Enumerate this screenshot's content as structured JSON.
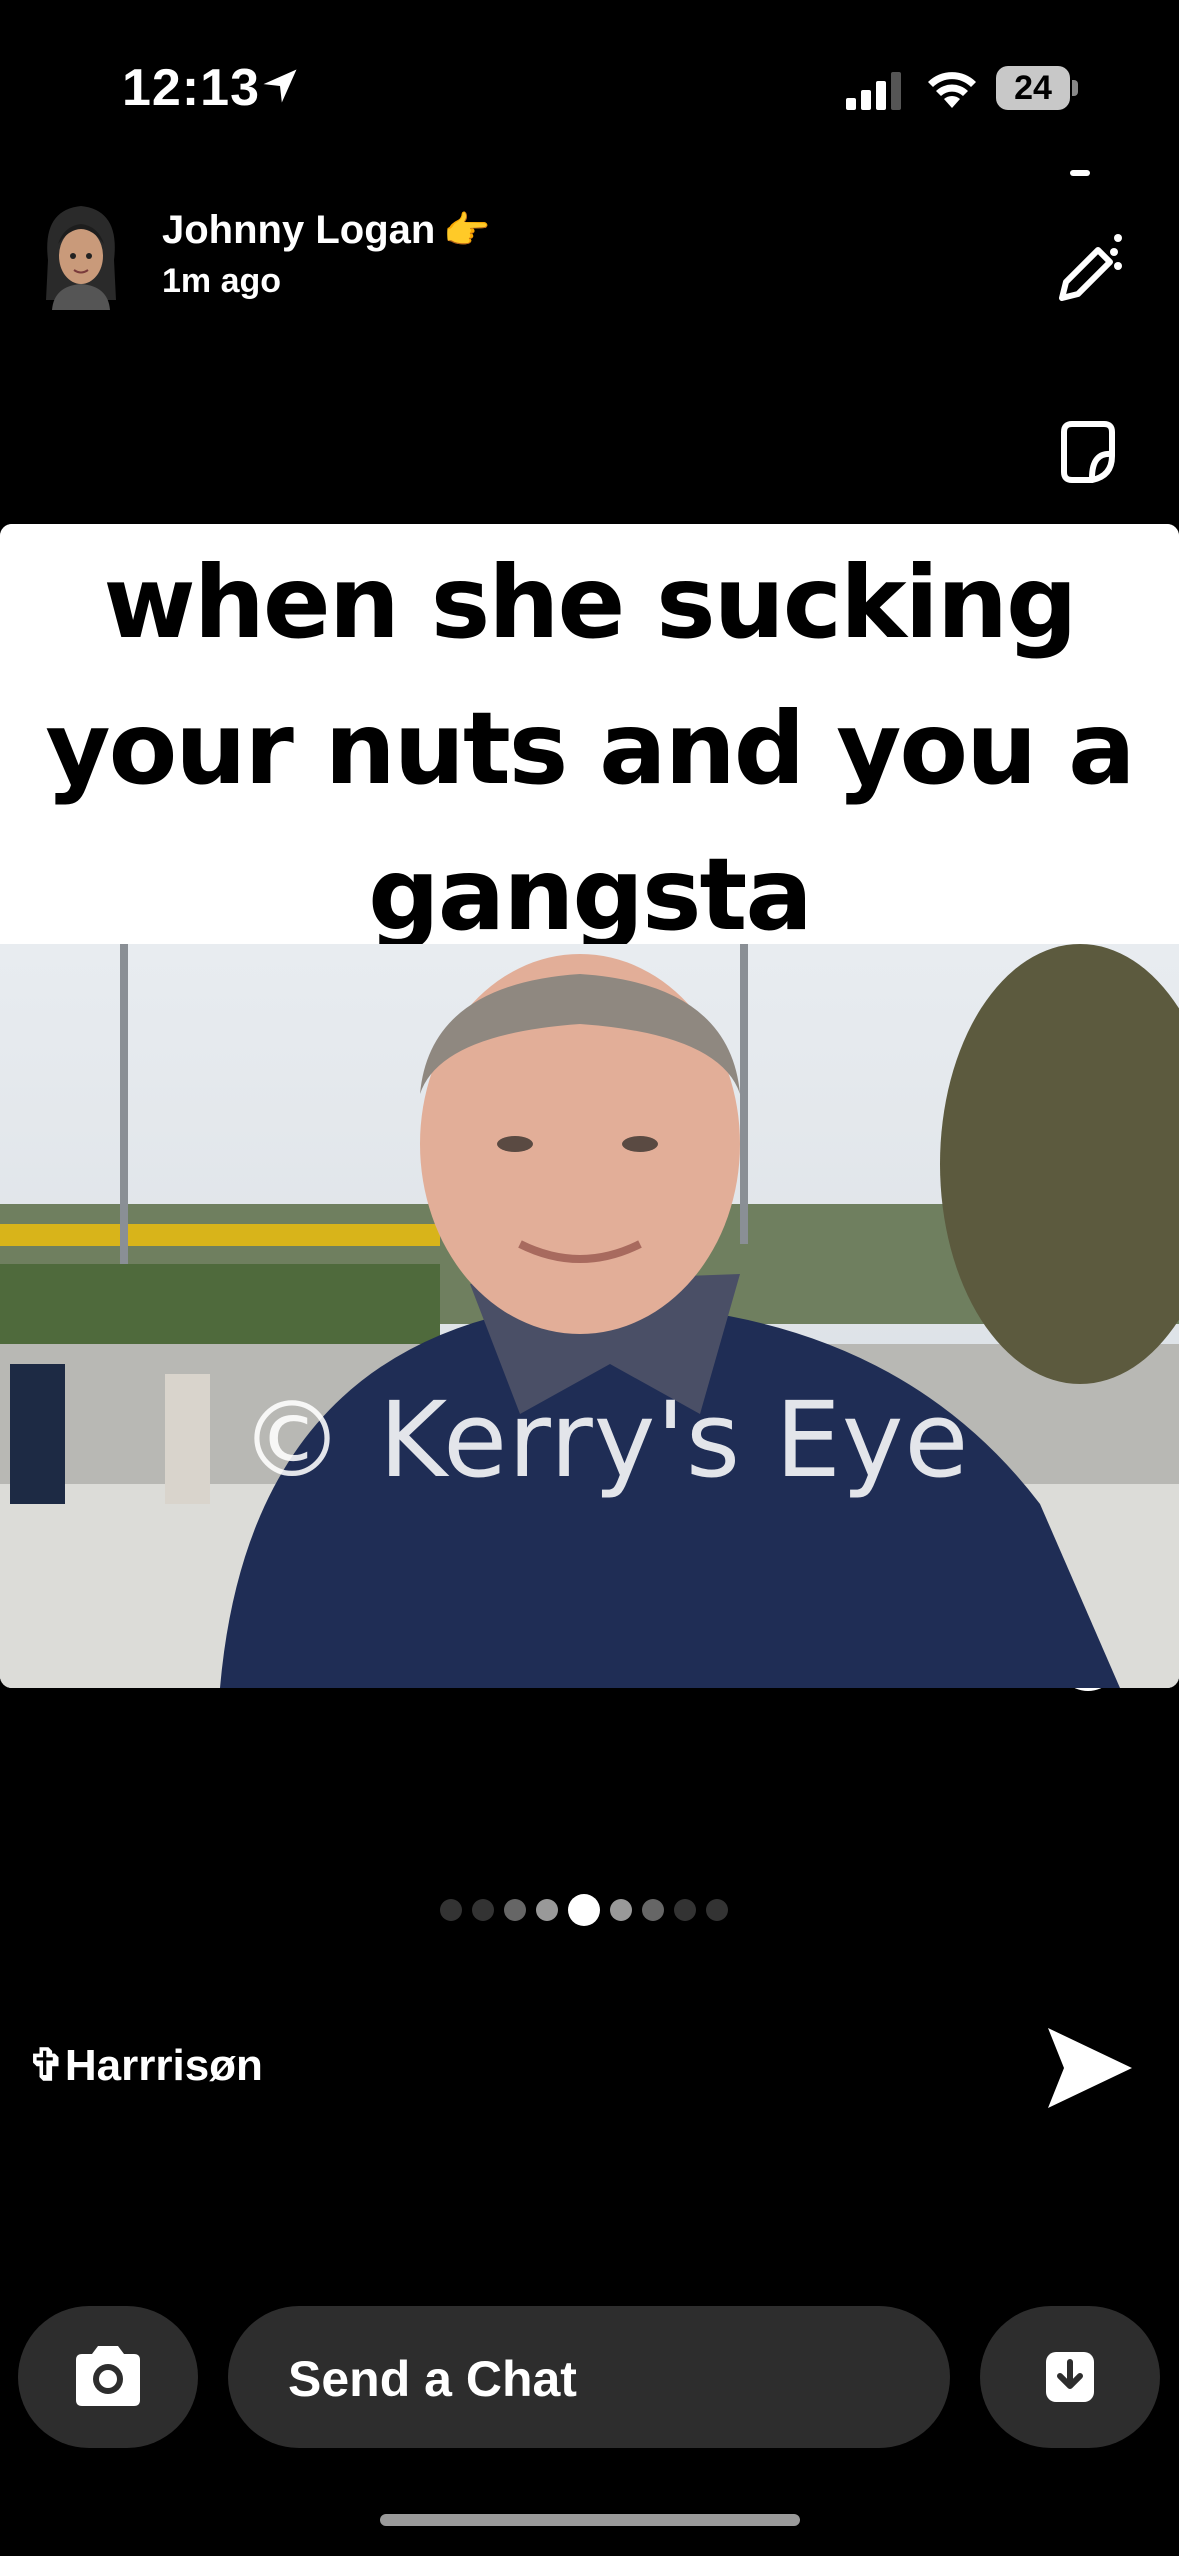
{
  "status_bar": {
    "time": "12:13",
    "battery": "24"
  },
  "header": {
    "sender_name": "Johnny Logan",
    "sender_emoji": "👉",
    "time_ago": "1m ago"
  },
  "toolbar": {
    "icons": [
      "pencil-icon",
      "sticker-icon",
      "scissors-icon",
      "music-icon",
      "lens-icon",
      "magic-wand-icon",
      "eraser-icon",
      "paperclip-icon",
      "crop-icon",
      "timer-icon"
    ]
  },
  "media": {
    "caption": "when she sucking your nuts and you a gangsta",
    "watermark": "© Kerry's Eye"
  },
  "pagination": {
    "count": 9,
    "active_index": 4
  },
  "recipient": {
    "name": "✞Harrrisøn"
  },
  "bottom_bar": {
    "chat_placeholder": "Send a Chat"
  }
}
